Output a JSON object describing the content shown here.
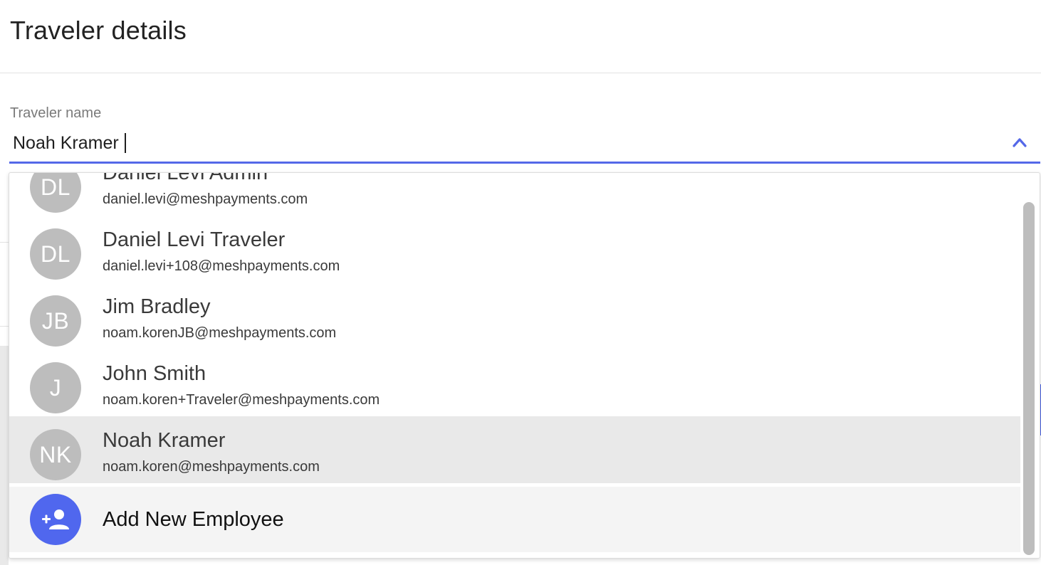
{
  "page": {
    "title": "Traveler details"
  },
  "traveler_field": {
    "label": "Traveler name",
    "value": "Noah Kramer",
    "toggle_icon": "chevron-up-icon"
  },
  "dropdown": {
    "options": [
      {
        "initials": "DL",
        "name": "Daniel Levi Admin",
        "email": "daniel.levi@meshpayments.com"
      },
      {
        "initials": "DL",
        "name": "Daniel Levi Traveler",
        "email": "daniel.levi+108@meshpayments.com"
      },
      {
        "initials": "JB",
        "name": "Jim Bradley",
        "email": "noam.korenJB@meshpayments.com"
      },
      {
        "initials": "J",
        "name": "John Smith",
        "email": "noam.koren+Traveler@meshpayments.com"
      },
      {
        "initials": "NK",
        "name": "Noah Kramer",
        "email": "noam.koren@meshpayments.com"
      }
    ],
    "highlighted_index": 4,
    "add_new": {
      "label": "Add New Employee",
      "icon": "add-person-icon"
    }
  },
  "colors": {
    "accent": "#5468e8",
    "avatar_gray": "#bdbdbd",
    "add_avatar_blue": "#5067ee",
    "highlight": "#e9e9e9"
  }
}
